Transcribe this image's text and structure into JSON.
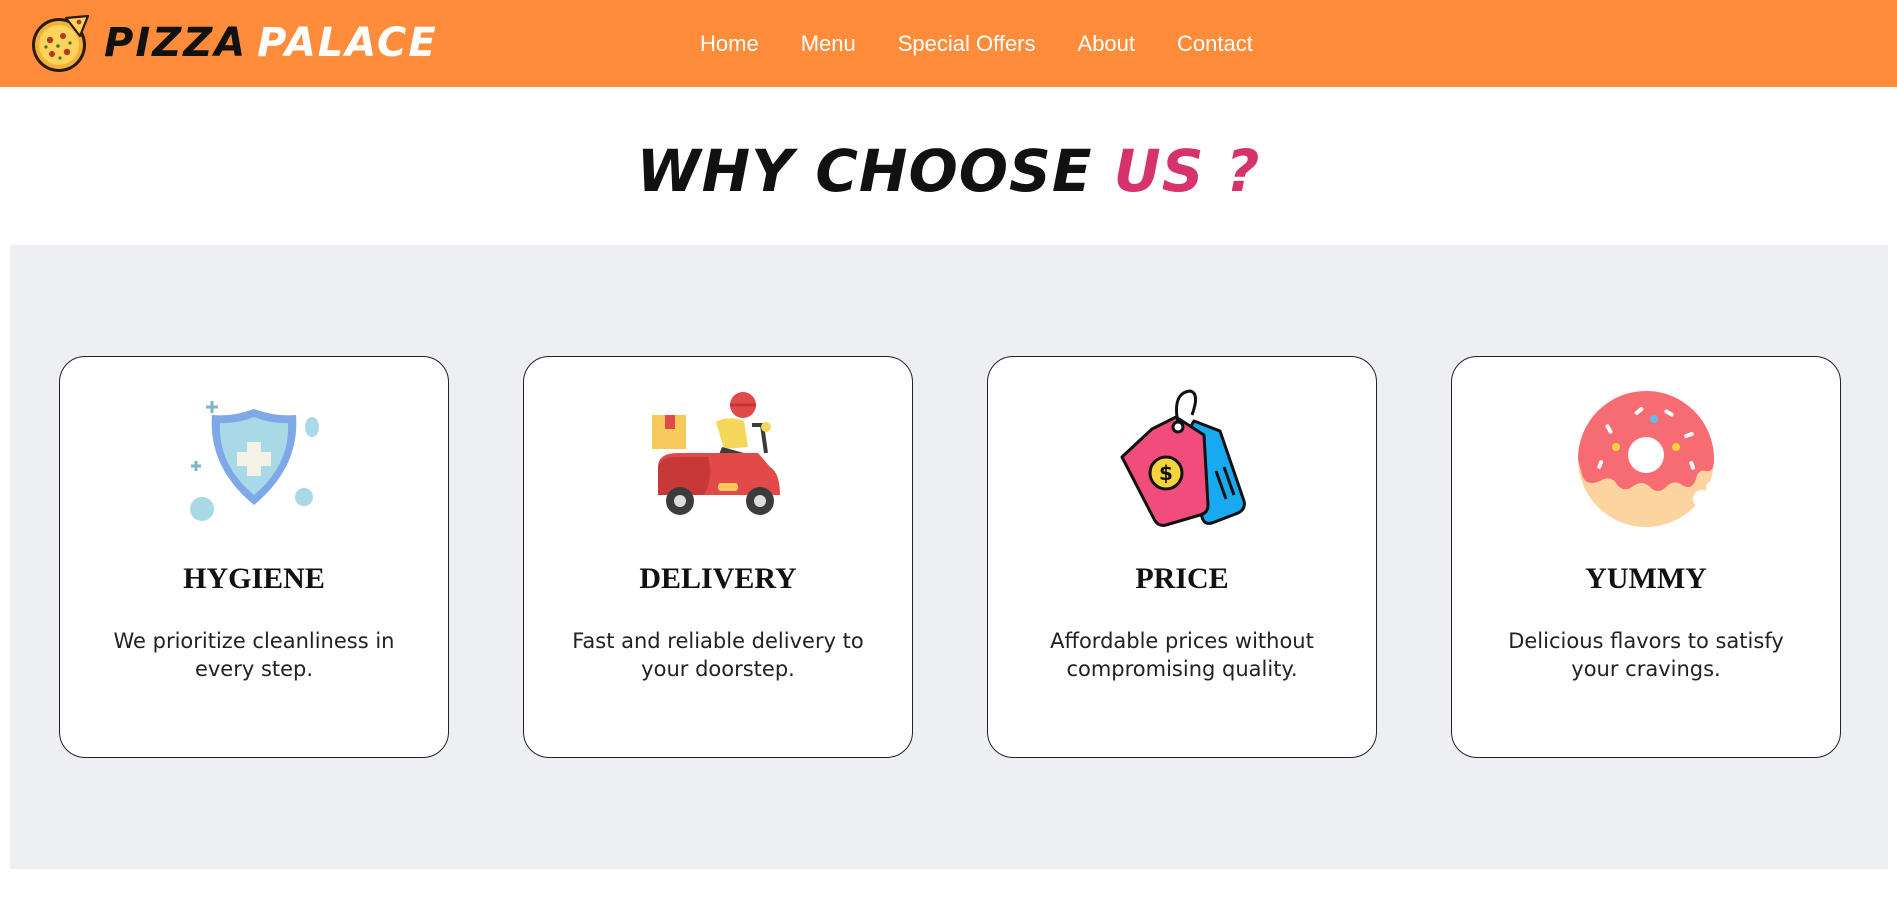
{
  "brand": {
    "word1": "PIZZA",
    "word2": "PALACE",
    "icon": "pizza-icon"
  },
  "nav": {
    "items": [
      "Home",
      "Menu",
      "Special Offers",
      "About",
      "Contact"
    ]
  },
  "section": {
    "title_main": "WHY CHOOSE ",
    "title_accent": "US ?"
  },
  "colors": {
    "header": "#FF8C3A",
    "accent": "#D6336C",
    "panel": "#EEEFF2"
  },
  "features": [
    {
      "icon": "shield-icon",
      "title": "HYGIENE",
      "text": "We prioritize cleanliness in every step."
    },
    {
      "icon": "delivery-scooter-icon",
      "title": "DELIVERY",
      "text": "Fast and reliable delivery to your doorstep."
    },
    {
      "icon": "price-tag-icon",
      "title": "PRICE",
      "text": "Affordable prices without compromising quality."
    },
    {
      "icon": "donut-icon",
      "title": "YUMMY",
      "text": "Delicious flavors to satisfy your cravings."
    }
  ]
}
